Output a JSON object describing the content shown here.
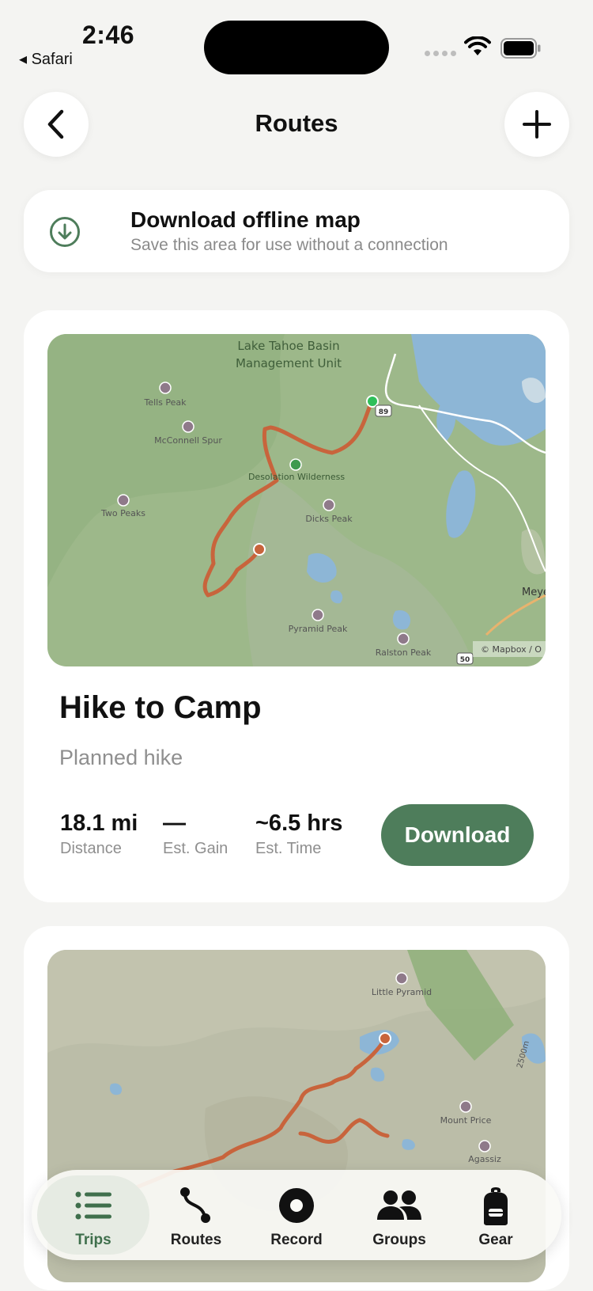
{
  "status_bar": {
    "time": "2:46",
    "back_app": "◂ Safari"
  },
  "header": {
    "title": "Routes"
  },
  "offline_banner": {
    "title": "Download offline map",
    "subtitle": "Save this area for use without a connection"
  },
  "routes": [
    {
      "title": "Hike to Camp",
      "subtitle": "Planned hike",
      "stats": [
        {
          "value": "18.1 mi",
          "label": "Distance"
        },
        {
          "value": "—",
          "label": "Est. Gain"
        },
        {
          "value": "~6.5 hrs",
          "label": "Est. Time"
        }
      ],
      "download_label": "Download",
      "map": {
        "labels": {
          "lake": "Lake Tahoe Basin",
          "lake2": "Management Unit",
          "tells": "Tells Peak",
          "mcconnell": "McConnell Spur",
          "desolation": "Desolation Wilderness",
          "twopeaks": "Two Peaks",
          "dicks": "Dicks Peak",
          "pyramid": "Pyramid Peak",
          "ralston": "Ralston Peak",
          "meyers": "Meye",
          "hwy89": "89",
          "hwy50": "50",
          "attribution": "© Mapbox / O"
        }
      }
    },
    {
      "map": {
        "labels": {
          "little": "Little Pyramid",
          "mountprice": "Mount Price",
          "agassiz": "Agassiz",
          "elev": "2500m"
        }
      }
    }
  ],
  "nav": {
    "items": [
      {
        "label": "Trips",
        "active": true
      },
      {
        "label": "Routes",
        "active": false
      },
      {
        "label": "Record",
        "active": false
      },
      {
        "label": "Groups",
        "active": false
      },
      {
        "label": "Gear",
        "active": false
      }
    ]
  },
  "colors": {
    "accent": "#4e7d5b",
    "route": "#c8643c",
    "start": "#2fbf5a"
  }
}
